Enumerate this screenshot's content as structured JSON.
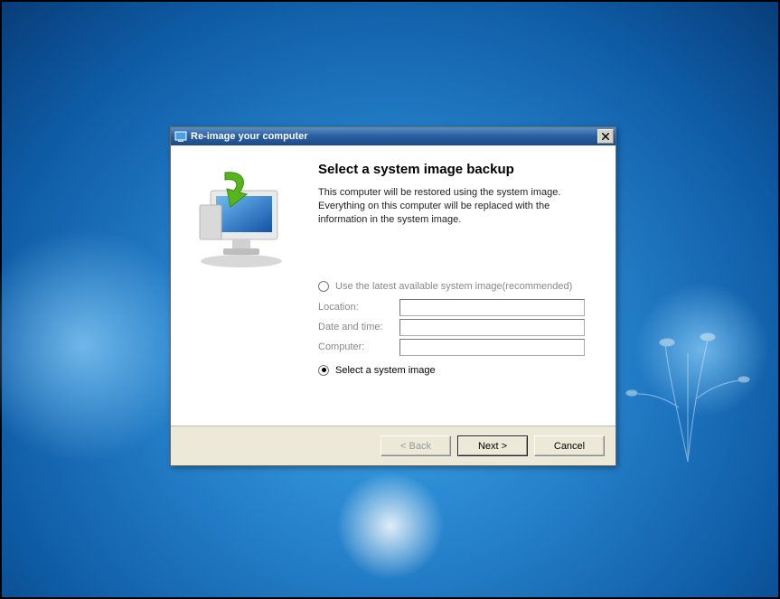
{
  "titlebar": {
    "title": "Re-image your computer"
  },
  "heading": "Select a system image backup",
  "description": "This computer will be restored using the system image. Everything on this computer will be replaced with the information in the system image.",
  "option_latest": "Use the latest available system image(recommended)",
  "fields": {
    "location_label": "Location:",
    "location_value": "",
    "datetime_label": "Date and time:",
    "datetime_value": "",
    "computer_label": "Computer:",
    "computer_value": ""
  },
  "option_select": "Select a system image",
  "buttons": {
    "back": "< Back",
    "next": "Next >",
    "cancel": "Cancel"
  }
}
